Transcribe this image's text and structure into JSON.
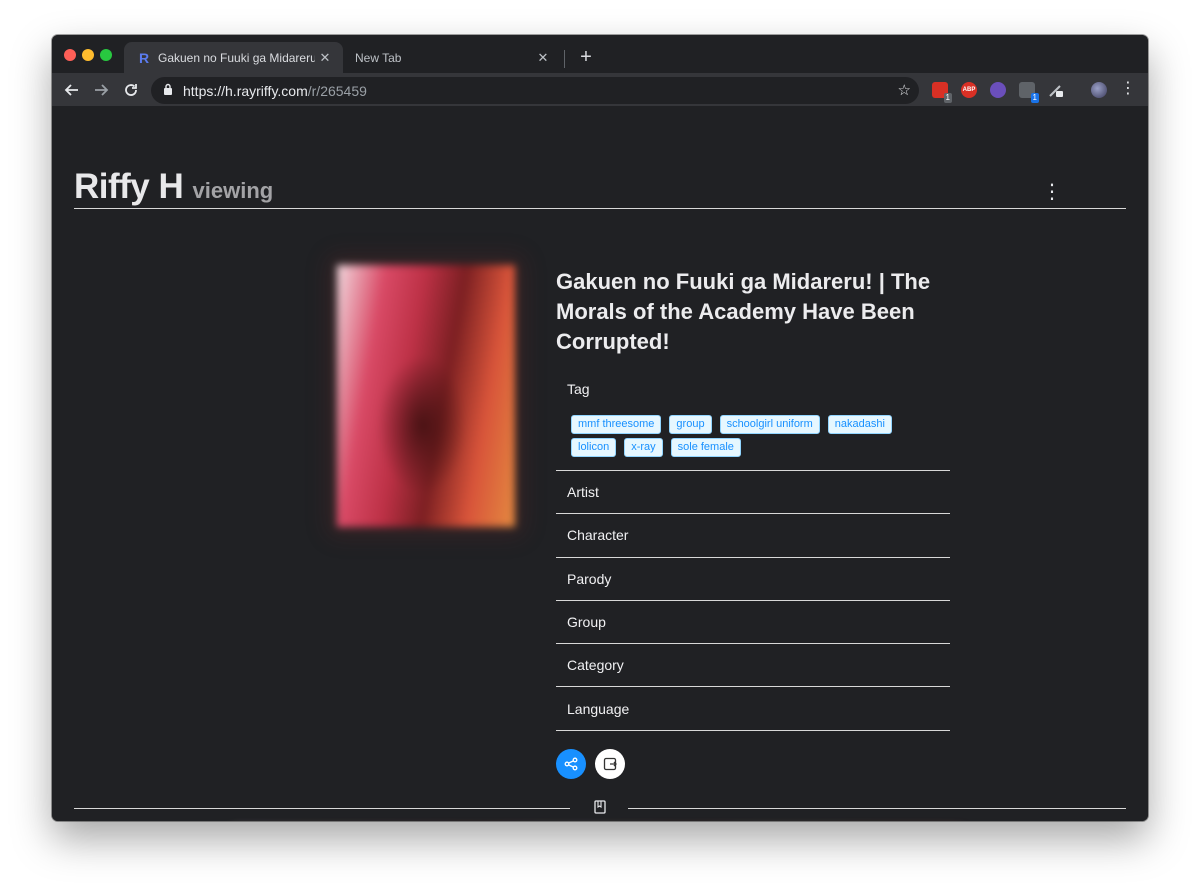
{
  "browser": {
    "tabs": [
      {
        "title": "Gakuen no Fuuki ga Midareru! | The Morals of the Academy Have Been Corrupted!",
        "favicon": "R",
        "active": true
      },
      {
        "title": "New Tab",
        "active": false
      }
    ],
    "url_host": "https://h.rayriffy.com",
    "url_path": "/r/265459",
    "extensions": [
      {
        "icon": "counter-extension-icon",
        "badge": "1",
        "color": "#d93025"
      },
      {
        "icon": "abp-icon",
        "label": "ABP",
        "color": "#d93025"
      },
      {
        "icon": "circle-extension-icon",
        "color": "#6b4fbb"
      },
      {
        "icon": "grid-extension-icon",
        "badge": "1",
        "color": "#5f6368"
      },
      {
        "icon": "pen-extension-icon",
        "color": "#bdc1c6"
      }
    ]
  },
  "site": {
    "brand": "Riffy H",
    "brand_sub": "viewing"
  },
  "gallery": {
    "title": "Gakuen no Fuuki ga Midareru! | The Morals of the Academy Have Been Corrupted!",
    "tag_label": "Tag",
    "tags": [
      "mmf threesome",
      "group",
      "schoolgirl uniform",
      "nakadashi",
      "lolicon",
      "x-ray",
      "sole female"
    ],
    "sections": [
      "Artist",
      "Character",
      "Parody",
      "Group",
      "Category",
      "Language"
    ]
  },
  "colors": {
    "accent": "#1890ff",
    "background": "#202124",
    "chip_bg": "#e6f7ff",
    "chip_border": "#91d5ff"
  }
}
